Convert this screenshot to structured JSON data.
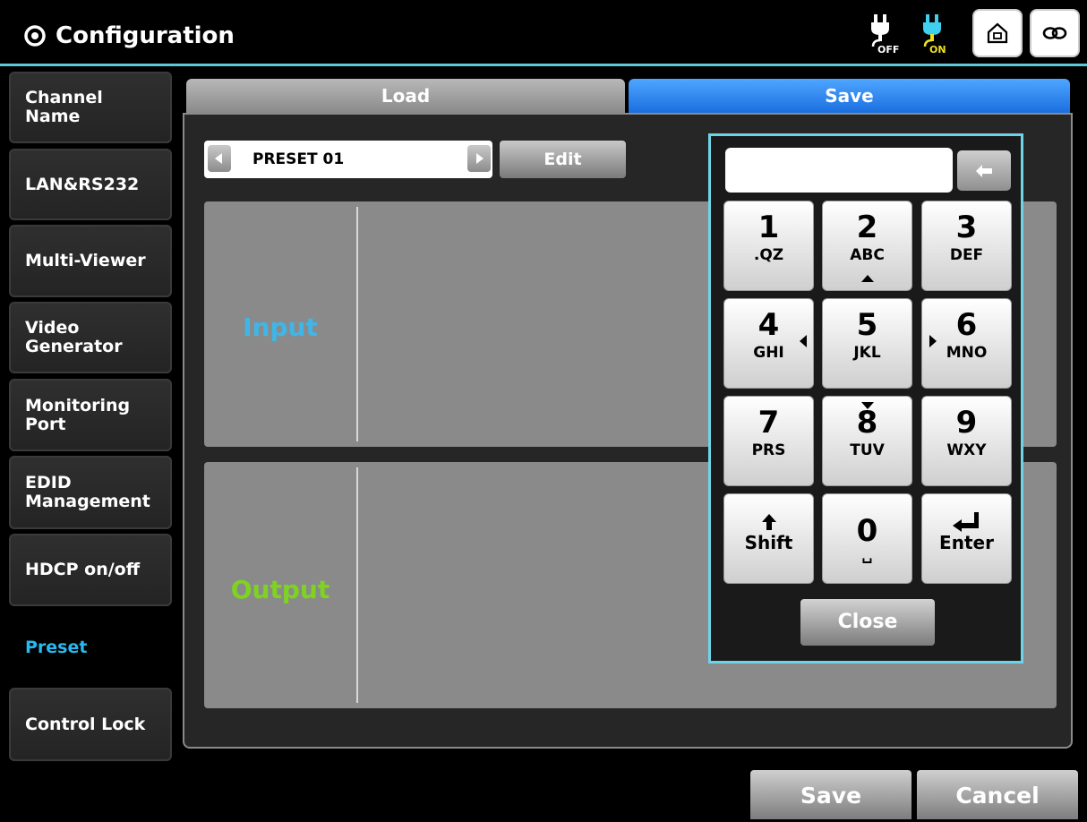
{
  "header": {
    "title": "Configuration",
    "icons": {
      "title": "gear-icon",
      "power_off": "plug-off-icon",
      "power_on": "plug-on-icon",
      "home": "home-icon",
      "link": "link-icon"
    },
    "power_off_label": "OFF",
    "power_on_label": "ON",
    "accent_color": "#5fc8d8"
  },
  "sidebar": {
    "items": [
      {
        "label": "Channel\nName"
      },
      {
        "label": "LAN&RS232"
      },
      {
        "label": "Multi-Viewer"
      },
      {
        "label": "Video\nGenerator"
      },
      {
        "label": "Monitoring\nPort"
      },
      {
        "label": "EDID\nManagement"
      },
      {
        "label": "HDCP on/off"
      },
      {
        "label": "Preset",
        "active": true
      },
      {
        "label": "Control Lock"
      }
    ],
    "active_color": "#29b8f0"
  },
  "tabs": {
    "load": "Load",
    "save": "Save",
    "active": "save"
  },
  "preset": {
    "name": "PRESET 01",
    "edit_label": "Edit"
  },
  "areas": {
    "input_label": "Input",
    "input_color": "#3fb6e8",
    "output_label": "Output",
    "output_color": "#7ed321"
  },
  "keypad": {
    "input_value": "",
    "keys": [
      {
        "digit": "1",
        "letters": ".QZ"
      },
      {
        "digit": "2",
        "letters": "ABC"
      },
      {
        "digit": "3",
        "letters": "DEF"
      },
      {
        "digit": "4",
        "letters": "GHI"
      },
      {
        "digit": "5",
        "letters": "JKL"
      },
      {
        "digit": "6",
        "letters": "MNO"
      },
      {
        "digit": "7",
        "letters": "PRS"
      },
      {
        "digit": "8",
        "letters": "TUV"
      },
      {
        "digit": "9",
        "letters": "WXY"
      },
      {
        "label": "Shift"
      },
      {
        "digit": "0",
        "letters": "␣"
      },
      {
        "label": "Enter"
      }
    ],
    "close_label": "Close"
  },
  "footer": {
    "save_label": "Save",
    "cancel_label": "Cancel"
  }
}
